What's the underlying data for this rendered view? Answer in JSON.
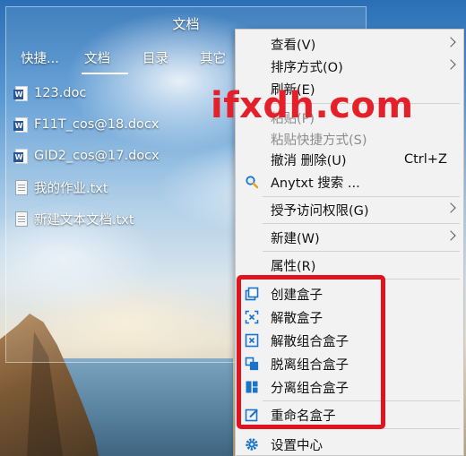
{
  "window": {
    "title": "文档"
  },
  "tabs": [
    {
      "label": "快捷..."
    },
    {
      "label": "文档"
    },
    {
      "label": "目录"
    },
    {
      "label": "其它"
    }
  ],
  "files": [
    {
      "name": "123.doc",
      "icon": "word-doc-icon"
    },
    {
      "name": "F11T_cos@18.docx",
      "icon": "word-doc-icon"
    },
    {
      "name": "GID2_cos@17.docx",
      "icon": "word-doc-icon"
    },
    {
      "name": "我的作业.txt",
      "icon": "text-file-icon"
    },
    {
      "name": "新建文本文档.txt",
      "icon": "text-file-icon"
    }
  ],
  "context_menu": {
    "items": [
      {
        "label": "查看(V)",
        "submenu": true
      },
      {
        "label": "排序方式(O)",
        "submenu": true
      },
      {
        "label": "刷新(E)"
      },
      {
        "label": "粘贴(P)",
        "disabled": true
      },
      {
        "label": "粘贴快捷方式(S)",
        "disabled": true
      },
      {
        "label": "撤消 删除(U)",
        "shortcut": "Ctrl+Z"
      },
      {
        "label": "Anytxt 搜索 ...",
        "icon": "search-icon"
      },
      {
        "label": "授予访问权限(G)",
        "submenu": true
      },
      {
        "label": "新建(W)",
        "submenu": true
      },
      {
        "label": "属性(R)"
      },
      {
        "label": "创建盒子",
        "icon": "create-box-icon"
      },
      {
        "label": "解散盒子",
        "icon": "dissolve-box-icon"
      },
      {
        "label": "解散组合盒子",
        "icon": "dissolve-group-box-icon"
      },
      {
        "label": "脱离组合盒子",
        "icon": "detach-group-box-icon"
      },
      {
        "label": "分离组合盒子",
        "icon": "split-group-box-icon"
      },
      {
        "label": "重命名盒子",
        "icon": "rename-box-icon"
      },
      {
        "label": "设置中心",
        "icon": "settings-gear-icon"
      }
    ]
  },
  "watermark": {
    "text": "ifxdh.com"
  },
  "colors": {
    "menu_background": "#f2f2f2",
    "icon_blue": "#1a73c8",
    "highlight_red": "#e0141e",
    "watermark_red": "#e4212a"
  }
}
